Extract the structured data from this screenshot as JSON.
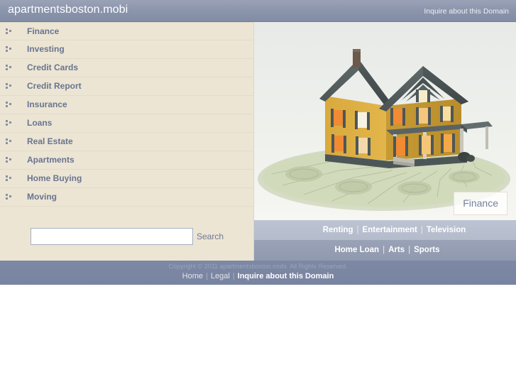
{
  "header": {
    "site_title": "apartmentsboston.mobi",
    "inquire_link": "Inquire about this Domain",
    "background_color": "#8b95ac",
    "title_color": "#ffffff"
  },
  "sidebar": {
    "background_color": "#ece5d4",
    "text_color": "#69748f",
    "bullet_icon": "three-dot-bullet-icon",
    "items": [
      {
        "label": "Finance"
      },
      {
        "label": "Investing"
      },
      {
        "label": "Credit Cards"
      },
      {
        "label": "Credit Report"
      },
      {
        "label": "Insurance"
      },
      {
        "label": "Loans"
      },
      {
        "label": "Real Estate"
      },
      {
        "label": "Apartments"
      },
      {
        "label": "Home Buying"
      },
      {
        "label": "Moving"
      }
    ]
  },
  "search": {
    "value": "",
    "placeholder": "",
    "button_label": "Search"
  },
  "hero": {
    "image_alt": "yellow-house-on-fan-of-dollar-bills",
    "tag_label": "Finance",
    "tag_color": "#77809b"
  },
  "link_bars": [
    {
      "background_color": "#b9c0d0",
      "links": [
        "Renting",
        "Entertainment",
        "Television"
      ]
    },
    {
      "background_color": "#969fb5",
      "links": [
        "Home Loan",
        "Arts",
        "Sports"
      ]
    }
  ],
  "footer": {
    "background_color": "#7c88a4",
    "copyright": "Copyright © 2011 apartmentsboston.mobi. All Rights Reserved.",
    "links": [
      {
        "label": "Home",
        "strong": false
      },
      {
        "label": "Legal",
        "strong": false
      },
      {
        "label": "Inquire about this Domain",
        "strong": true
      }
    ],
    "separator": "|"
  }
}
